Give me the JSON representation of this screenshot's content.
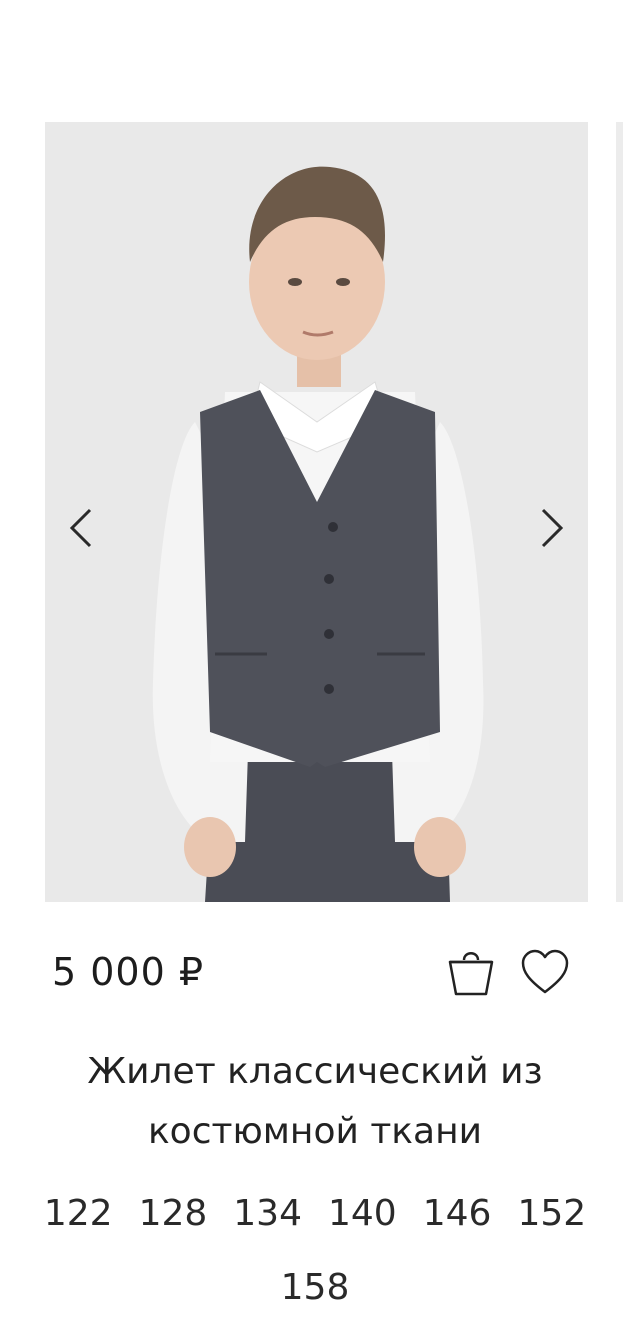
{
  "product": {
    "price": "5 000 ₽",
    "title": "Жилет классический из костюмной ткани",
    "sizes": [
      "122",
      "128",
      "134",
      "140",
      "146",
      "152",
      "158"
    ]
  },
  "gallery": {
    "photo_description": "product-photo-boy-in-grey-vest"
  },
  "icons": {
    "prev": "chevron-left-icon",
    "next": "chevron-right-icon",
    "cart": "shopping-bag-icon",
    "favorite": "heart-icon"
  },
  "colors": {
    "background": "#ffffff",
    "photo_bg": "#e9e9e9",
    "vest": "#4e5059",
    "shirt": "#f6f6f6",
    "text": "#1d1d1d"
  }
}
